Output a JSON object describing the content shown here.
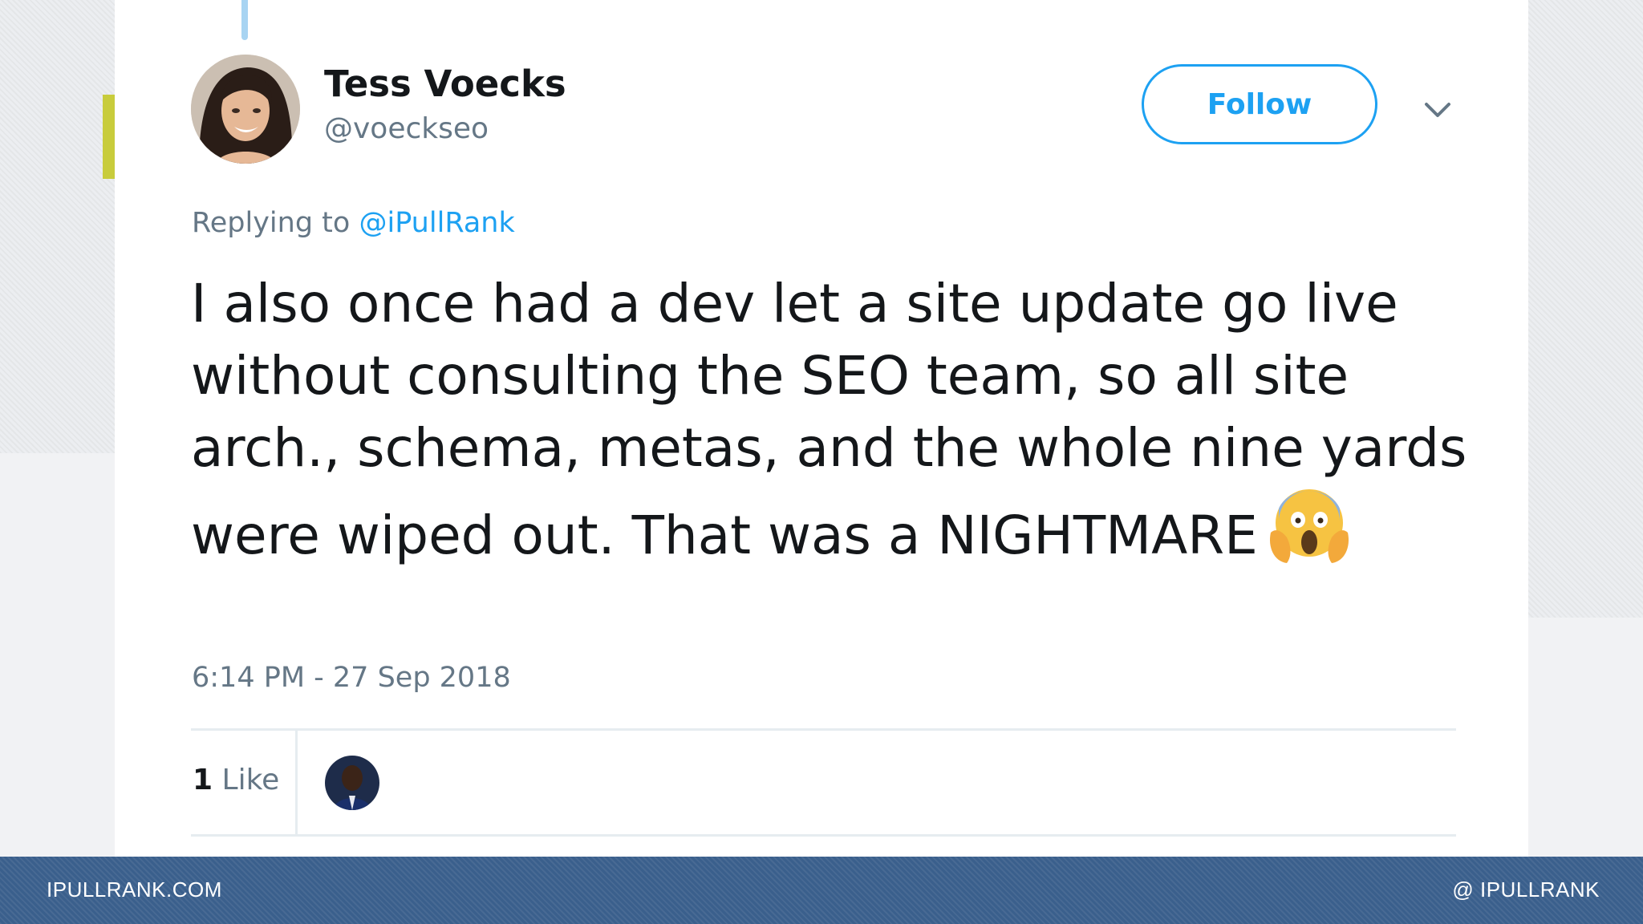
{
  "tweet": {
    "author_name": "Tess Voecks",
    "author_handle": "@voeckseo",
    "follow_label": "Follow",
    "replying_prefix": "Replying to",
    "replying_handle": "@iPullRank",
    "text": "I also once had a dev let a site update go live without consulting the SEO team, so all site arch., schema, metas, and the whole nine yards were wiped out. That was a NIGHTMARE",
    "emoji": "face-screaming-in-fear-icon",
    "timestamp": "6:14 PM - 27 Sep 2018",
    "like_count": "1",
    "like_label": "Like"
  },
  "footer": {
    "left": "IPULLRANK.COM",
    "right": "@ IPULLRANK"
  },
  "colors": {
    "accent_blue": "#1da1f2",
    "accent_yellow": "#c8cc3c",
    "footer_bg": "#3a5f8c",
    "muted_text": "#657786"
  }
}
